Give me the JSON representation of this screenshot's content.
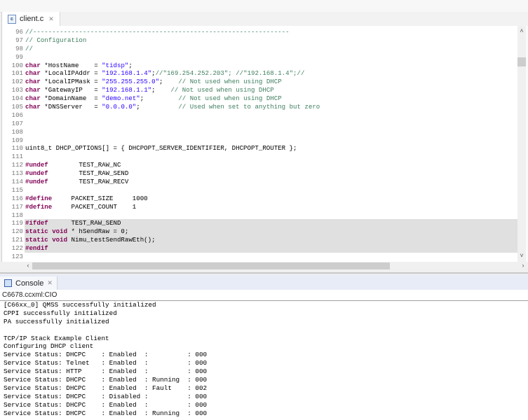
{
  "editor": {
    "tab_label": "client.c",
    "tab_icon": "c-file-icon",
    "lines": [
      {
        "n": "96",
        "tokens": [
          {
            "c": "cm",
            "t": "//-------------------------------------------------------------------"
          }
        ]
      },
      {
        "n": "97",
        "tokens": [
          {
            "c": "cm",
            "t": "// Configuration"
          }
        ]
      },
      {
        "n": "98",
        "tokens": [
          {
            "c": "cm",
            "t": "//"
          }
        ]
      },
      {
        "n": "99",
        "tokens": []
      },
      {
        "n": "100",
        "tokens": [
          {
            "c": "kw",
            "t": "char"
          },
          {
            "c": "pl",
            "t": " *HostName    = "
          },
          {
            "c": "str",
            "t": "\"tidsp\""
          },
          {
            "c": "pl",
            "t": ";"
          }
        ]
      },
      {
        "n": "101",
        "tokens": [
          {
            "c": "kw",
            "t": "char"
          },
          {
            "c": "pl",
            "t": " *LocalIPAddr = "
          },
          {
            "c": "str",
            "t": "\"192.168.1.4\""
          },
          {
            "c": "pl",
            "t": ";"
          },
          {
            "c": "cm",
            "t": "//\"169.254.252.203\"; //\"192.168.1.4\";//"
          }
        ]
      },
      {
        "n": "102",
        "tokens": [
          {
            "c": "kw",
            "t": "char"
          },
          {
            "c": "pl",
            "t": " *LocalIPMask = "
          },
          {
            "c": "str",
            "t": "\"255.255.255.0\""
          },
          {
            "c": "pl",
            "t": ";    "
          },
          {
            "c": "cm",
            "t": "// Not used when using DHCP"
          }
        ]
      },
      {
        "n": "103",
        "tokens": [
          {
            "c": "kw",
            "t": "char"
          },
          {
            "c": "pl",
            "t": " *GatewayIP   = "
          },
          {
            "c": "str",
            "t": "\"192.168.1.1\""
          },
          {
            "c": "pl",
            "t": ";    "
          },
          {
            "c": "cm",
            "t": "// Not used when using DHCP"
          }
        ]
      },
      {
        "n": "104",
        "tokens": [
          {
            "c": "kw",
            "t": "char"
          },
          {
            "c": "pl",
            "t": " *DomainName  = "
          },
          {
            "c": "str",
            "t": "\"demo.net\""
          },
          {
            "c": "pl",
            "t": ";         "
          },
          {
            "c": "cm",
            "t": "// Not used when using DHCP"
          }
        ]
      },
      {
        "n": "105",
        "tokens": [
          {
            "c": "kw",
            "t": "char"
          },
          {
            "c": "pl",
            "t": " *DNSServer   = "
          },
          {
            "c": "str",
            "t": "\"0.0.0.0\""
          },
          {
            "c": "pl",
            "t": ";          "
          },
          {
            "c": "cm",
            "t": "// Used when set to anything but zero"
          }
        ]
      },
      {
        "n": "106",
        "tokens": []
      },
      {
        "n": "107",
        "tokens": []
      },
      {
        "n": "108",
        "tokens": []
      },
      {
        "n": "109",
        "tokens": []
      },
      {
        "n": "110",
        "tokens": [
          {
            "c": "pl",
            "t": "uint8_t DHCP_OPTIONS[] = { DHCPOPT_SERVER_IDENTIFIER, DHCPOPT_ROUTER };"
          }
        ]
      },
      {
        "n": "111",
        "tokens": []
      },
      {
        "n": "112",
        "tokens": [
          {
            "c": "kw",
            "t": "#undef"
          },
          {
            "c": "pl",
            "t": "        TEST_RAW_NC"
          }
        ]
      },
      {
        "n": "113",
        "tokens": [
          {
            "c": "kw",
            "t": "#undef"
          },
          {
            "c": "pl",
            "t": "        TEST_RAW_SEND"
          }
        ]
      },
      {
        "n": "114",
        "tokens": [
          {
            "c": "kw",
            "t": "#undef"
          },
          {
            "c": "pl",
            "t": "        TEST_RAW_RECV"
          }
        ]
      },
      {
        "n": "115",
        "tokens": []
      },
      {
        "n": "116",
        "tokens": [
          {
            "c": "kw",
            "t": "#define"
          },
          {
            "c": "pl",
            "t": "     PACKET_SIZE     1000"
          }
        ]
      },
      {
        "n": "117",
        "tokens": [
          {
            "c": "kw",
            "t": "#define"
          },
          {
            "c": "pl",
            "t": "     PACKET_COUNT    1"
          }
        ]
      },
      {
        "n": "118",
        "tokens": []
      },
      {
        "n": "119",
        "hl": true,
        "tokens": [
          {
            "c": "kw",
            "t": "#ifdef"
          },
          {
            "c": "pl",
            "t": "      TEST_RAW_SEND"
          }
        ]
      },
      {
        "n": "120",
        "hl": true,
        "tokens": [
          {
            "c": "kw",
            "t": "static void"
          },
          {
            "c": "pl",
            "t": " * hSendRaw = 0;"
          }
        ]
      },
      {
        "n": "121",
        "hl": true,
        "tokens": [
          {
            "c": "kw",
            "t": "static void"
          },
          {
            "c": "pl",
            "t": " Nimu_testSendRawEth();"
          }
        ]
      },
      {
        "n": "122",
        "hl": true,
        "tokens": [
          {
            "c": "kw",
            "t": "#endif"
          }
        ]
      },
      {
        "n": "123",
        "tokens": []
      }
    ]
  },
  "console": {
    "tab_label": "Console",
    "tab_icon": "console-icon",
    "header": "C6678.ccxml:CIO",
    "lines": [
      "[C66xx_0] QMSS successfully initialized",
      "CPPI successfully initialized",
      "PA successfully initialized",
      "",
      "TCP/IP Stack Example Client",
      "Configuring DHCP client",
      "Service Status: DHCPC    : Enabled  :          : 000",
      "Service Status: Telnet   : Enabled  :          : 000",
      "Service Status: HTTP     : Enabled  :          : 000",
      "Service Status: DHCPC    : Enabled  : Running  : 000",
      "Service Status: DHCPC    : Enabled  : Fault    : 002",
      "Service Status: DHCPC    : Disabled :          : 000",
      "Service Status: DHCPC    : Enabled  :          : 000",
      "Service Status: DHCPC    : Enabled  : Running  : 000"
    ]
  },
  "colors": {
    "keyword": "#7f0055",
    "string": "#2a00ff",
    "comment": "#3f7f5f",
    "line_number": "#787878",
    "highlight": "#e0e0e0"
  }
}
